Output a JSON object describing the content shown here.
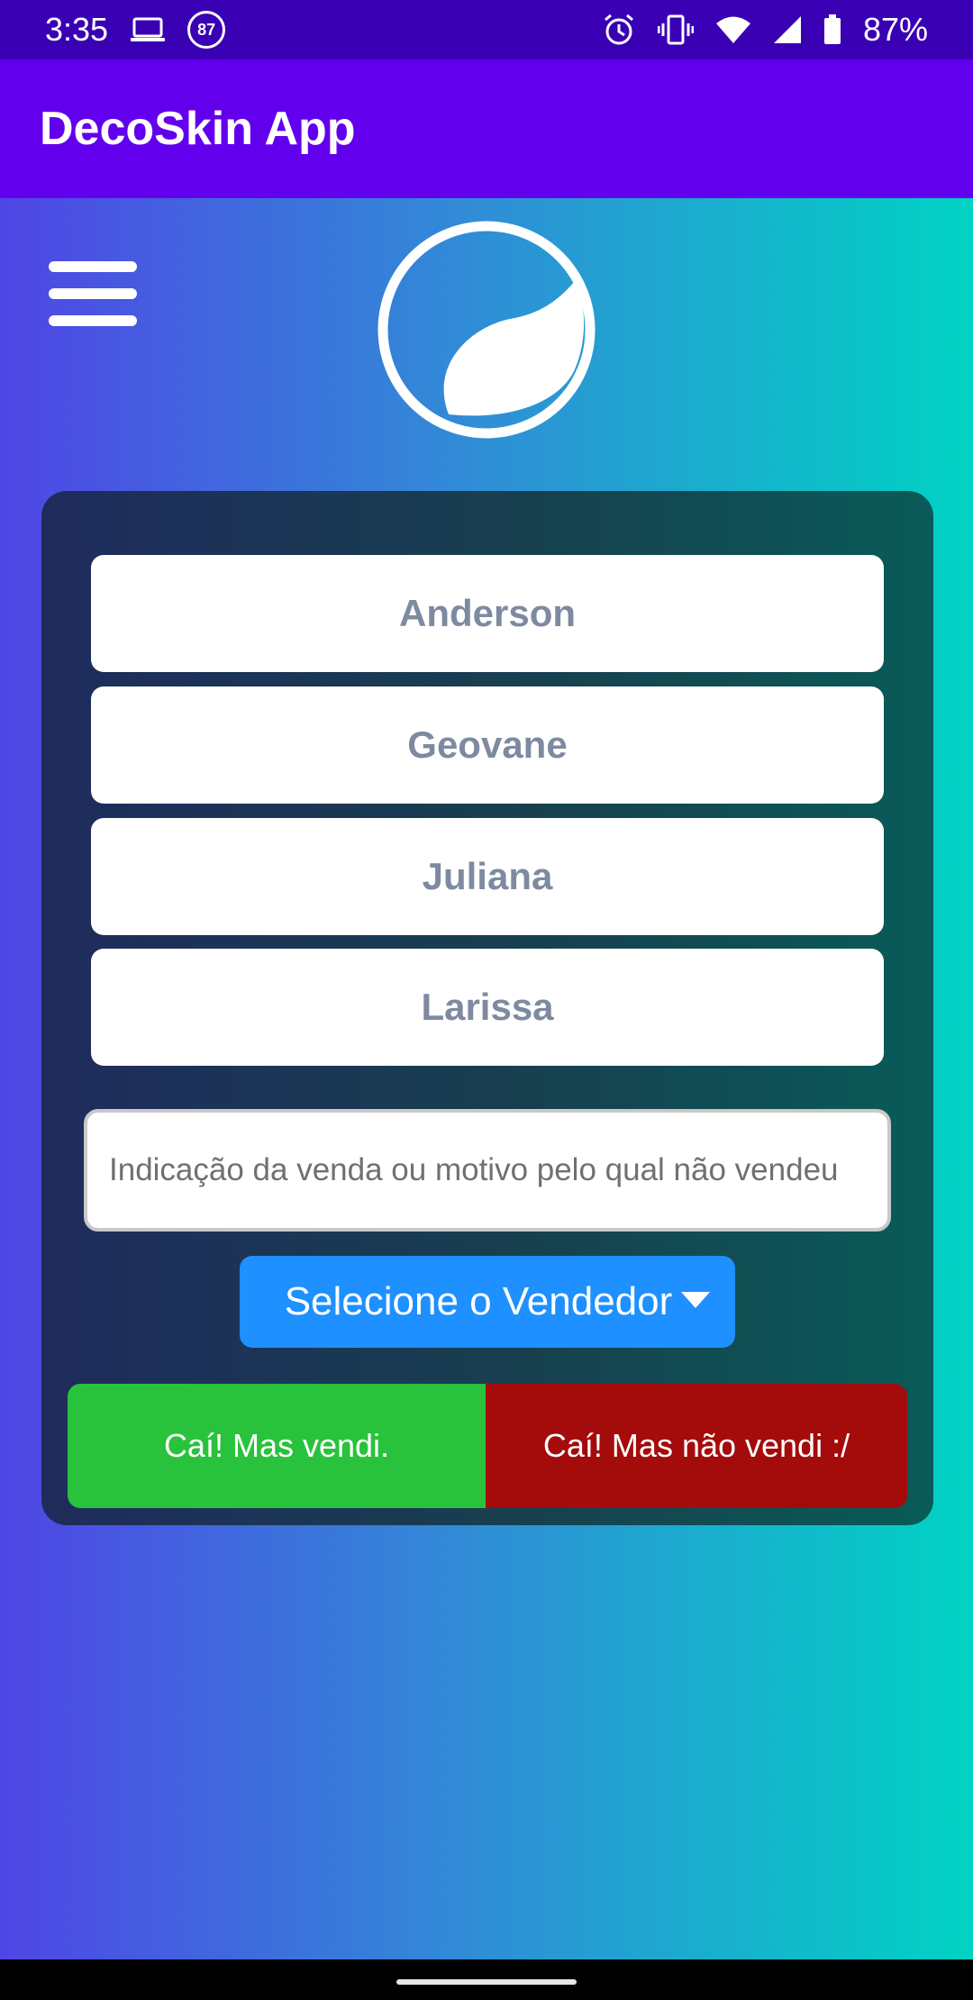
{
  "status_bar": {
    "time": "3:35",
    "notification_badge": "87",
    "battery": "87%",
    "icons": [
      "laptop-icon",
      "alarm-icon",
      "vibrate-icon",
      "wifi-icon",
      "signal-icon",
      "battery-icon"
    ]
  },
  "app_bar": {
    "title": "DecoSkin App"
  },
  "sellers": [
    "Anderson",
    "Geovane",
    "Juliana",
    "Larissa"
  ],
  "form": {
    "reason_placeholder": "Indicação da venda ou motivo pelo qual não vendeu",
    "seller_select_label": "Selecione o Vendedor"
  },
  "actions": {
    "sold_label": "Caí! Mas vendi.",
    "not_sold_label": "Caí! Mas não vendi :/"
  },
  "colors": {
    "status_bar": "#3a00b4",
    "app_bar": "#6200ee",
    "sold": "#29c23c",
    "not_sold": "#a40b0b",
    "select": "#1e90ff"
  }
}
